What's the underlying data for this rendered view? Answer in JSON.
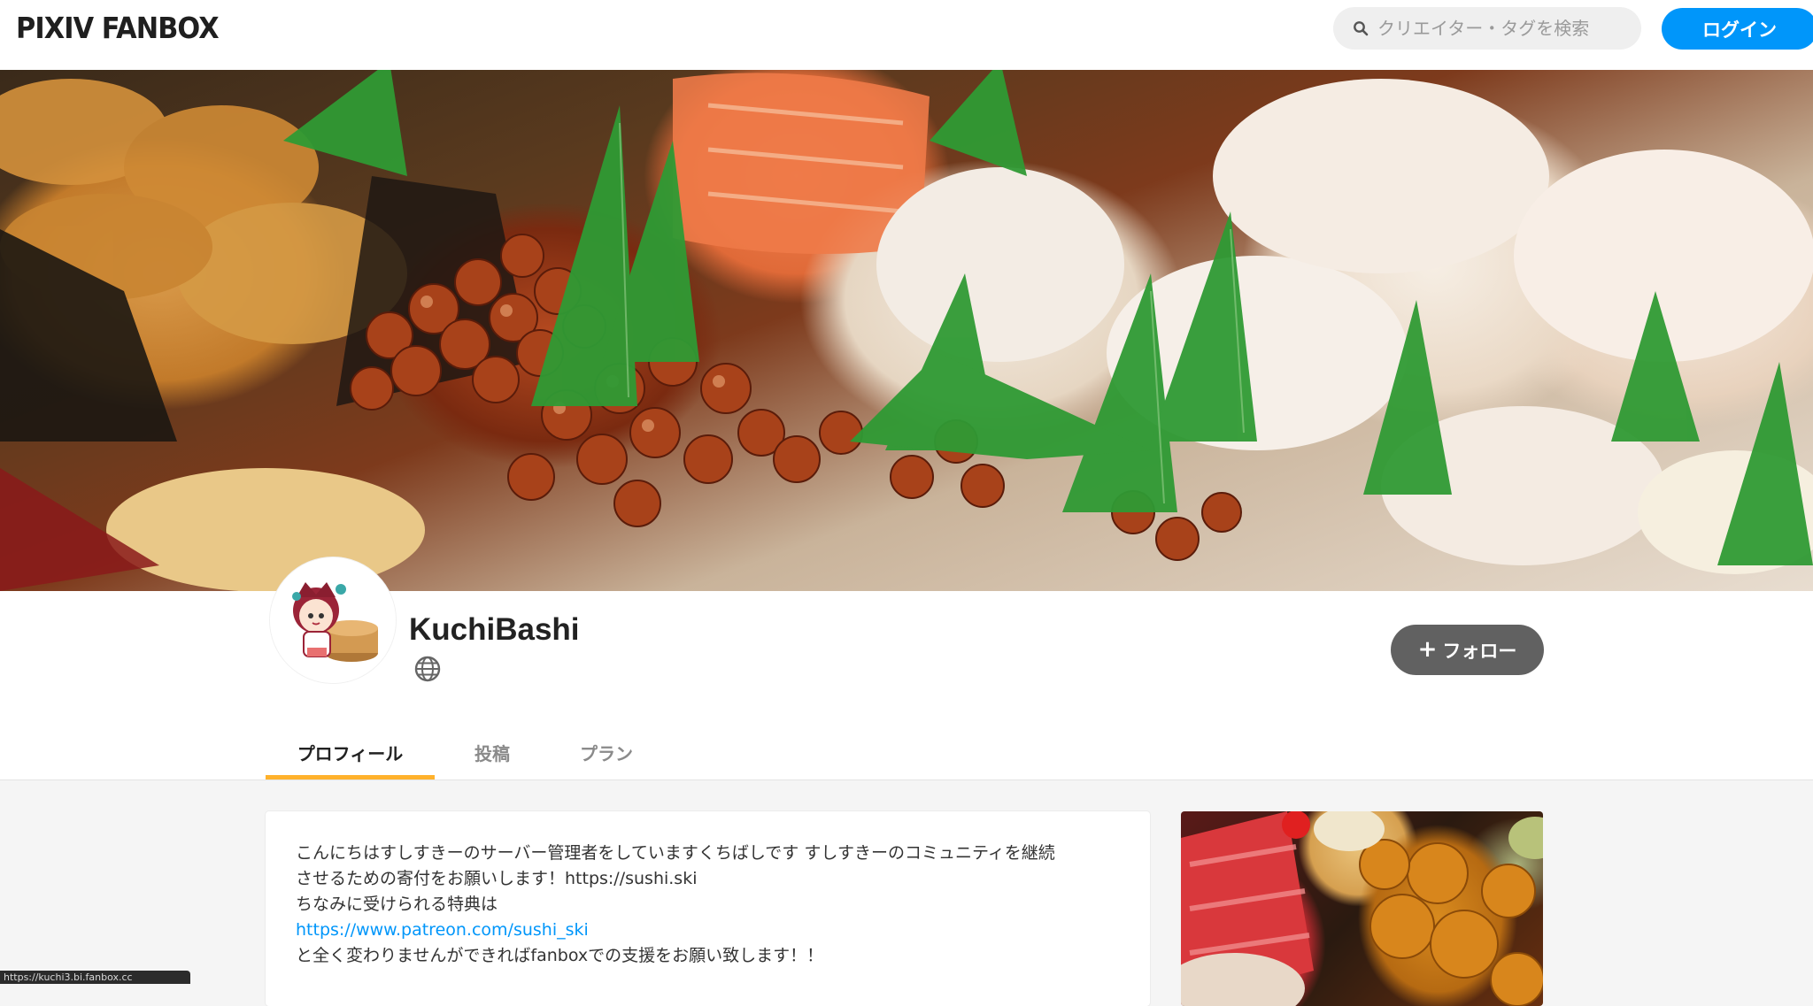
{
  "header": {
    "logo": "PIXIV FANBOX",
    "search_placeholder": "クリエイター・タグを検索",
    "login_label": "ログイン"
  },
  "creator": {
    "name": "KuchiBashi",
    "follow_label": "フォロー"
  },
  "tabs": [
    {
      "label": "プロフィール",
      "active": true
    },
    {
      "label": "投稿",
      "active": false
    },
    {
      "label": "プラン",
      "active": false
    }
  ],
  "intro": {
    "line1": "こんにちはすしすきーのサーバー管理者をしていますくちばしです すしすきーのコミュニティを継続",
    "line2": "させるための寄付をお願いします！https://sushi.ski",
    "line3": "ちなみに受けられる特典は",
    "link": "https://www.patreon.com/sushi_ski",
    "line4": "と全く変わりませんができればfanboxでの支援をお願い致します！！"
  },
  "status_bar": {
    "url": "https://kuchi3.bi.fanbox.cc"
  },
  "colors": {
    "accent": "#0096fa",
    "tab_underline": "#ffb12b",
    "follow_button": "#616161"
  },
  "icons": [
    "search-icon",
    "globe-icon",
    "plus-icon"
  ]
}
